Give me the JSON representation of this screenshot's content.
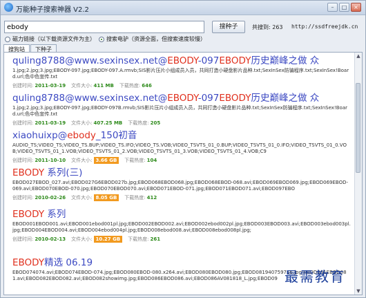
{
  "window": {
    "title": "万能种子搜索神器 V2.2",
    "min": "–",
    "max": "□",
    "close": "×"
  },
  "search": {
    "query": "ebody",
    "button": "搜种子",
    "total_label": "共搜到: 263",
    "site": "http://ssdfreejdk.cn"
  },
  "options": {
    "left": "磁力链接（以下载资源文件为主）",
    "right": "搜索电驴（资源全面，但搜索速度较慢）"
  },
  "tabs": [
    "搜狗站",
    "下种子"
  ],
  "labels": {
    "created": "创建时间:",
    "size": "文件大小:",
    "heat": "下载热度:"
  },
  "results": [
    {
      "title_pre": "quling8788@www.sexinsex.net@",
      "title_hl": "EBODY",
      "title_mid": "-097",
      "title_hl2": "EBODY",
      "title_post": "历史巅峰之做 众",
      "files": "1.jpg;2.jpg;3.jpg;EBODY-097.jpg;EBODY-097.A.rmvb;SIS影片压片小组成员入员，共同打造小硬盘影片品种.txt;SexInSex防骗程序.txt;SexInSex!Board.url;色中色宣传.txt",
      "date": "2011-03-19",
      "size": "411 MB",
      "heat": "646",
      "size_badge": false
    },
    {
      "title_pre": "quling8788@www.sexinsex.net@",
      "title_hl": "EBODY",
      "title_mid": "-097",
      "title_hl2": "EBODY",
      "title_post": "历史巅峰之做 众",
      "files": "1.jpg;2.jpg;3.jpg;EBODY-097.jpg;EBODY-097B.rmvb;SIS影片压片小组成员入员，共同打造小硬盘影片品种.txt;SexInSex防骗程序.txt;SexInSex!Board.url;色中色宣传.txt",
      "date": "2011-03-19",
      "size": "407.25 MB",
      "heat": "205",
      "size_badge": false
    },
    {
      "title_pre": "xiaohuixp@",
      "title_hl": "ebody",
      "title_mid": "_150初音",
      "title_hl2": "",
      "title_post": "",
      "files": "AUDIO_TS;VIDEO_TS;VIDEO_TS.BUP;VIDEO_TS.IFO;VIDEO_TS.VOB;VIDEO_TSVTS_01_0.BUP;VIDEO_TSVTS_01_0.IFO;VIDEO_TSVTS_01_0.VOB;VIDEO_TSVTS_01_1.VOB;VIDEO_TSVTS_01_2.VOB;VIDEO_TSVTS_01_3.VOB;VIDEO_TSVTS_01_4.VOB;C9",
      "date": "2011-10-10",
      "size": "3.66 GB",
      "heat": "104",
      "size_badge": true
    },
    {
      "title_pre": "",
      "title_hl": "EBODY",
      "title_mid": " 系列(三)",
      "title_hl2": "",
      "title_post": "",
      "files": "EBOD027EBOD_027.avi;EBOD027G6EBOD027b.jpg;EBOD068EBOD068.jpg;EBOD068EBOD-068.avi;EBOD069EBOD069.jpg;EBOD069EBOD-069.avi;EBOD070EBOD-070.jpg;EBOD070EBOD070.avi;EBOD071EBOD-071.jpg;EBOD071EBOD071.avi;EBOD097EBO",
      "date": "2010-02-26",
      "size": "8.05 GB",
      "heat": "412",
      "size_badge": true
    },
    {
      "title_pre": "",
      "title_hl": "EBODY",
      "title_mid": " 系列",
      "title_hl2": "",
      "title_post": "",
      "files": "EBOD001EBOD001.avi;EBOD001ebod001pl.jpg;EBOD002EBOD002.avi;EBOD002ebod002pl.jpg;EBOD003EBOD003.avi;EBOD003ebod003pl.jpg;EBOD004EBOD004.avi;EBOD004ebod004pl.jpg;EBOD008ebod008.avi;EBOD008ebod008pl.jpg;",
      "date": "2010-02-13",
      "size": "10.27 GB",
      "heat": "261",
      "size_badge": true
    },
    {
      "title_pre": "",
      "title_hl": "EBODY",
      "title_mid": "精选 06.19",
      "title_hl2": "",
      "title_post": "",
      "files": "EBOD074074.avi;EBOD074EBOD-074.jpg;EBOD080EBOD-080.x264.avi;EBOD080EBOD080.jpg;EBOD081940759716.jpg;EBOD081EBOD081.avi;EBOD082EBOD082.avi;EBOD082showimg.jpg;EBOD086EBOD086.avi;EBOD086AV081818_L.jpg;EBOD09",
      "date": "",
      "size": "",
      "heat": "",
      "size_badge": false
    }
  ],
  "watermark": "最需教育",
  "colors": {
    "title": "#3c49c2",
    "highlight": "#e0301e",
    "meta_value": "#2d8a1a",
    "badge": "#f29a1f"
  }
}
